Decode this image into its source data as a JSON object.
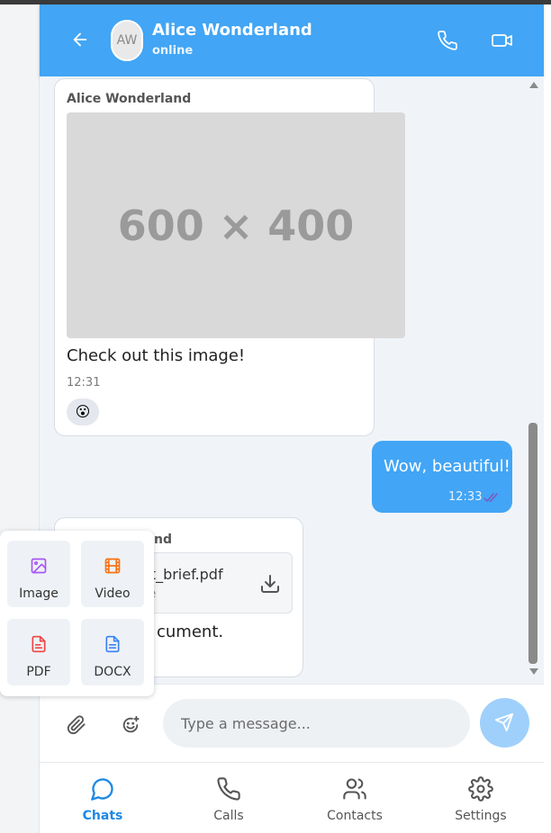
{
  "header": {
    "back_icon": "arrow-left-icon",
    "avatar_initials": "AW",
    "contact_name": "Alice Wonderland",
    "status": "online",
    "call_icon": "phone-icon",
    "video_icon": "video-camera-icon",
    "color": "#42a5f5"
  },
  "messages": [
    {
      "direction": "incoming",
      "sender": "Alice Wonderland",
      "image_placeholder": "600 × 400",
      "text": "Check out this image!",
      "time": "12:31",
      "reaction": "😮"
    },
    {
      "direction": "outgoing",
      "text": "Wow, beautiful!",
      "time": "12:33",
      "status_icon": "double-check-icon"
    },
    {
      "direction": "incoming",
      "sender_visible": "nd",
      "file_name_visible": "ct_brief.pdf",
      "file_type_visible": "ile",
      "download_icon": "download-icon",
      "text_visible": "cument."
    }
  ],
  "attach_menu": {
    "items": [
      {
        "label": "Image",
        "icon": "image-icon",
        "color": "#a855f7"
      },
      {
        "label": "Video",
        "icon": "film-icon",
        "color": "#f97316"
      },
      {
        "label": "PDF",
        "icon": "pdf-file-icon",
        "color": "#ef4444"
      },
      {
        "label": "DOCX",
        "icon": "doc-file-icon",
        "color": "#3b82f6"
      }
    ]
  },
  "composer": {
    "placeholder": "Type a message...",
    "attach_icon": "paperclip-icon",
    "emoji_icon": "emoji-add-icon",
    "send_icon": "send-icon"
  },
  "nav": {
    "items": [
      {
        "label": "Chats",
        "icon": "chat-bubble-icon",
        "active": true
      },
      {
        "label": "Calls",
        "icon": "phone-icon",
        "active": false
      },
      {
        "label": "Contacts",
        "icon": "users-icon",
        "active": false
      },
      {
        "label": "Settings",
        "icon": "gear-icon",
        "active": false
      }
    ],
    "active_color": "#1e88e5"
  }
}
